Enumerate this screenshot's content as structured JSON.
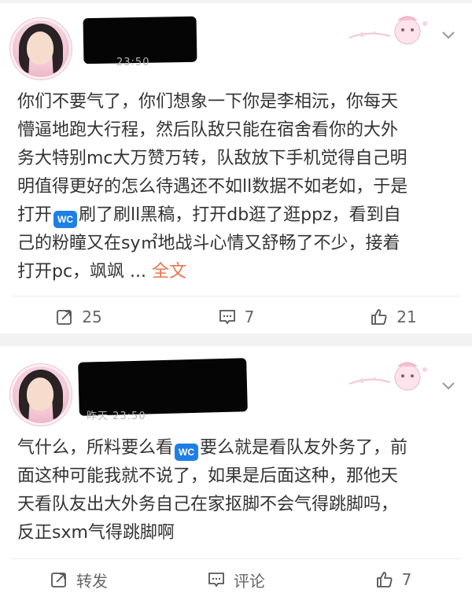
{
  "posts": [
    {
      "time": "23:50",
      "lines": [
        [
          "你们不要气了，你们想象一下你是李相沅，你每天"
        ],
        [
          "懵逼地跑大行程，然后队敌只能在宿舍看你的大外"
        ],
        [
          "务大特别mc大万赞万转，队敌放下手机觉得自己明"
        ],
        [
          "明值得更好的怎么待遇还不如ll数据不如老如，于是"
        ],
        [
          "打开",
          "刷了刷ll黑稿，打开db逛了逛ppz，看到自"
        ],
        [
          "己的粉瞳又在sy㎡地战斗心情又舒畅了不少，接着"
        ],
        [
          "打开pc，飒飒 ... "
        ]
      ],
      "badge_text": "WC",
      "full_text_label": "全文",
      "actions": {
        "repost": "25",
        "comment": "7",
        "like": "21"
      }
    },
    {
      "time": "昨天 23:50",
      "lines": [
        [
          "气什么，所料要么看",
          "要么就是看队友外务了，前"
        ],
        [
          "面这种可能我就不说了，如果是后面这种，那他天"
        ],
        [
          "天看队友出大外务自己在家抠脚不会气得跳脚吗，"
        ],
        [
          "反正sxm气得跳脚啊"
        ]
      ],
      "badge_text": "WC",
      "actions": {
        "repost": "转发",
        "comment": "评论",
        "like": "7"
      }
    }
  ],
  "icons": {
    "repost": "repost-icon",
    "comment": "comment-icon",
    "like": "like-icon",
    "chevron": "chevron-down-icon"
  },
  "colors": {
    "link": "#eb7350",
    "badge": "#1e7fe5",
    "text": "#333333",
    "meta": "#b5b5b5"
  }
}
